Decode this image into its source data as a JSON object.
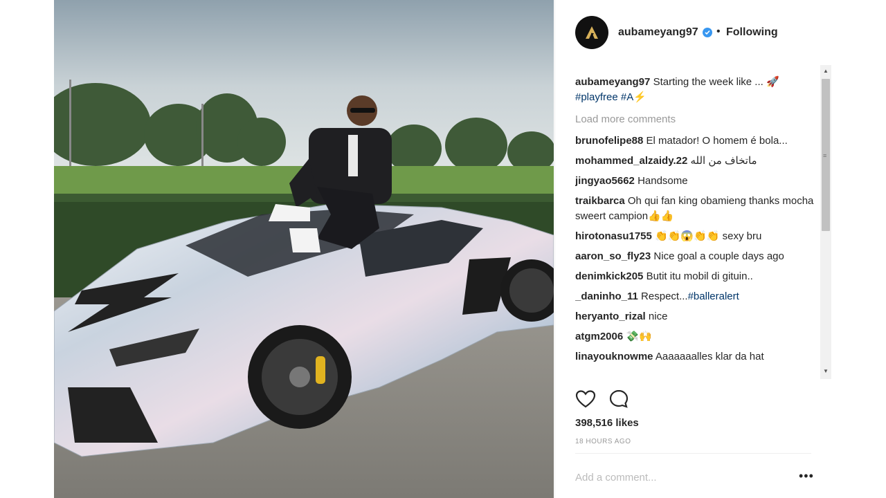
{
  "post": {
    "username": "aubameyang97",
    "follow_status": "Following",
    "separator": "•",
    "avatar_icon": "aubameyang-logo-icon",
    "caption": {
      "user": "aubameyang97",
      "text": "Starting the week like ... 🚀",
      "hashtags": [
        "#playfree",
        "#A⚡"
      ]
    },
    "load_more": "Load more comments",
    "comments": [
      {
        "user": "brunofelipe88",
        "text": "El matador! O homem é bola..."
      },
      {
        "user": "mohammed_alzaidy.22",
        "text": "ماتخاف من الله"
      },
      {
        "user": "jingyao5662",
        "text": "Handsome"
      },
      {
        "user": "traikbarca",
        "text": "Oh qui fan king obamieng thanks mocha sweert campion👍👍"
      },
      {
        "user": "hirotonasu1755",
        "text": "👏👏😱👏👏 sexy bru"
      },
      {
        "user": "aaron_so_fly23",
        "text": "Nice goal a couple days ago"
      },
      {
        "user": "denimkick205",
        "text": "Butit itu mobil di gituin.."
      },
      {
        "user": "_daninho_11",
        "text": "Respect...",
        "tag": "#balleralert"
      },
      {
        "user": "heryanto_rizal",
        "text": "nice"
      },
      {
        "user": "atgm2006",
        "text": "💸🙌"
      },
      {
        "user": "linayouknowme",
        "text": "Aaaaaaalles klar da hat"
      }
    ],
    "likes": "398,516 likes",
    "time": "18 HOURS AGO",
    "add_comment_placeholder": "Add a comment...",
    "more_label": "•••",
    "icons": [
      "heart-icon",
      "comment-icon",
      "verified-badge-icon",
      "more-options-icon"
    ]
  },
  "scrollbar": {
    "up": "▲",
    "down": "▼",
    "grip": "≡"
  },
  "colors": {
    "verified": "#3897f0",
    "hashtag": "#003569",
    "muted": "#999999",
    "text": "#262626"
  }
}
